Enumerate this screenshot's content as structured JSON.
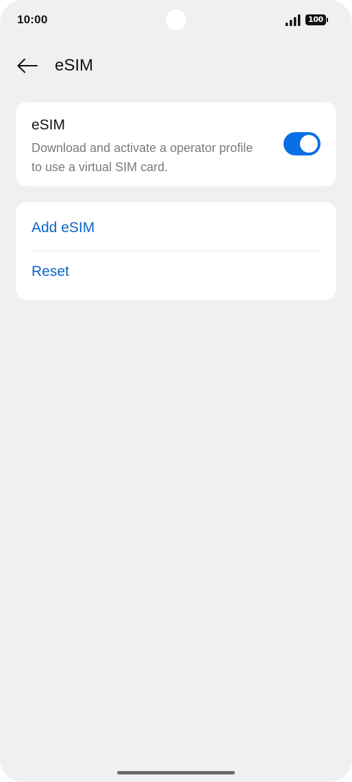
{
  "status_bar": {
    "time": "10:00",
    "battery_level": "100",
    "signal_icon": "signal-bars-icon",
    "battery_icon": "battery-icon"
  },
  "header": {
    "back_icon": "arrow-left-icon",
    "title": "eSIM"
  },
  "esim_card": {
    "title": "eSIM",
    "description": "Download and activate a operator profile to use a virtual SIM card.",
    "toggle_on": true
  },
  "actions": {
    "add_label": "Add eSIM",
    "reset_label": "Reset"
  },
  "colors": {
    "accent": "#0a6ee6",
    "link": "#0a64c8",
    "background": "#eff0f2",
    "card": "#ffffff"
  }
}
